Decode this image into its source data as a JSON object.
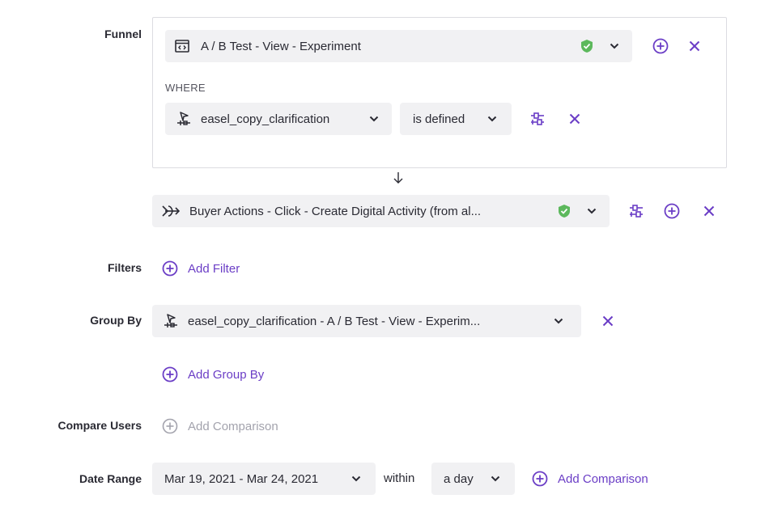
{
  "labels": {
    "funnel": "Funnel",
    "filters": "Filters",
    "group_by": "Group By",
    "compare_users": "Compare Users",
    "date_range": "Date Range"
  },
  "funnel": {
    "step1": {
      "event": "A / B Test - View - Experiment",
      "verified": true,
      "icon": "page-view-icon"
    },
    "where_label": "WHERE",
    "where": {
      "property": "easel_copy_clarification",
      "operator": "is defined",
      "icon": "property-icon"
    },
    "step2": {
      "event": "Buyer Actions - Click - Create Digital Activity (from al...",
      "verified": true,
      "icon": "click-arrow-icon"
    }
  },
  "filters": {
    "add_label": "Add Filter"
  },
  "group_by": {
    "value": "easel_copy_clarification - A / B Test - View - Experim...",
    "icon": "property-icon",
    "add_label": "Add Group By"
  },
  "compare_users": {
    "add_label": "Add Comparison",
    "disabled": true
  },
  "date_range": {
    "value": "Mar 19, 2021 - Mar 24, 2021",
    "within_label": "within",
    "window": "a day",
    "add_comparison_label": "Add Comparison"
  },
  "colors": {
    "accent": "#6b3ec6",
    "verified": "#5cb85c",
    "pill_bg": "#f1f1f3",
    "text": "#2a2a33",
    "disabled": "#a3a3ad"
  }
}
